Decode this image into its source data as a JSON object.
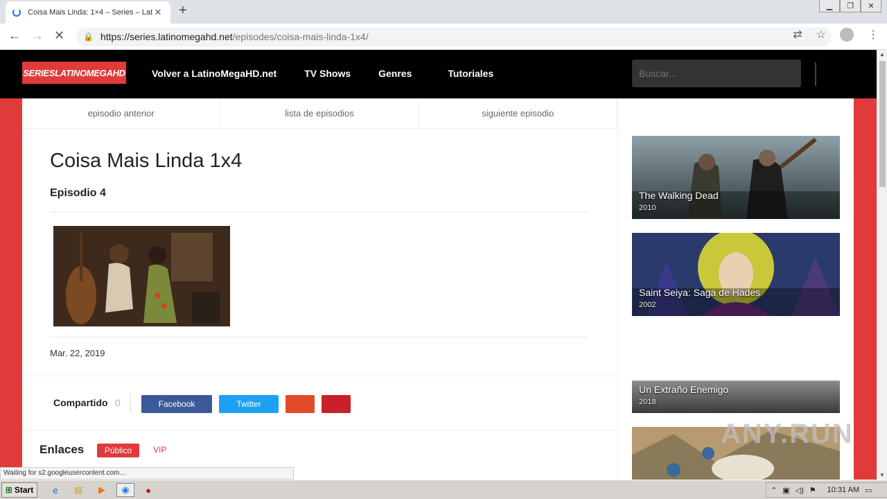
{
  "browser": {
    "tab_title": "Coisa Mais Linda: 1×4 – Series – Lat",
    "tab_close": "✕",
    "new_tab": "+",
    "url_host": "https://series.latinomegahd.net",
    "url_path": "/episodes/coisa-mais-linda-1x4/",
    "status_text": "Waiting for s2.googleusercontent.com..."
  },
  "header": {
    "logo": "SERIESLATINOMEGAHD",
    "menu": [
      "Volver a LatinoMegaHD.net",
      "TV Shows",
      "Genres",
      "Tutoriales"
    ],
    "search_placeholder": "Buscar..."
  },
  "episode_nav": {
    "prev": "episodio anterior",
    "list": "lista de episodios",
    "next": "siguiente episodio"
  },
  "episode": {
    "title": "Coisa Mais Linda 1x4",
    "subtitle": "Episodio 4",
    "date": "Mar. 22, 2019"
  },
  "share": {
    "label": "Compartido",
    "count": "0",
    "facebook": "Facebook",
    "twitter": "Twitter",
    "colors": {
      "facebook": "#3b5998",
      "twitter": "#1da1f2",
      "google": "#e34a2b",
      "pinterest": "#cb2027"
    }
  },
  "links": {
    "label": "Enlaces",
    "public": "Público",
    "vip": "VIP"
  },
  "sidebar": {
    "items": [
      {
        "title": "The Walking Dead",
        "year": "2010"
      },
      {
        "title": "Saint Seiya: Saga de Hades",
        "year": "2002"
      },
      {
        "title": "Un Extraño Enemigo",
        "year": "2018"
      }
    ]
  },
  "watermark": "ANY.RUN",
  "taskbar": {
    "start": "Start",
    "clock": "10:31 AM"
  },
  "accent_color": "#e03a3a"
}
